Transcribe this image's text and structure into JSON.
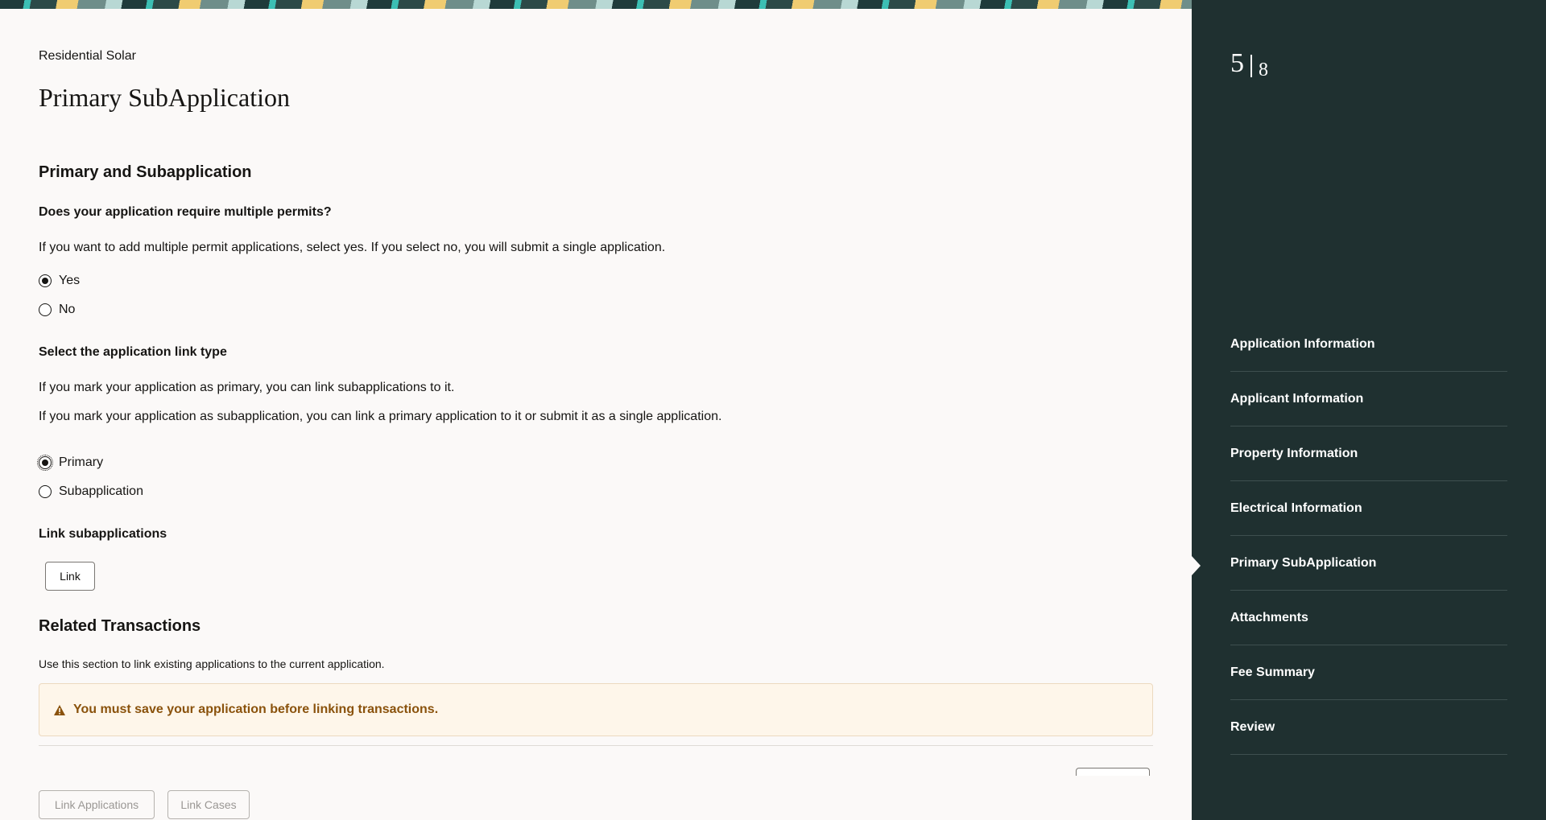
{
  "header": {
    "eyebrow": "Residential Solar",
    "title": "Primary SubApplication"
  },
  "section": {
    "title": "Primary and Subapplication",
    "multiple_permits": {
      "question": "Does your application require multiple permits?",
      "help": "If you want to add multiple permit applications, select yes. If you select no, you will submit a single application.",
      "options": [
        "Yes",
        "No"
      ],
      "selected": "Yes"
    },
    "link_type": {
      "question": "Select the application link type",
      "help1": "If you mark your application as primary, you can link subapplications to it.",
      "help2": "If you mark your application as subapplication, you can link a primary application to it or submit it as a single application.",
      "options": [
        "Primary",
        "Subapplication"
      ],
      "selected": "Primary"
    },
    "link_sub": {
      "title": "Link subapplications",
      "button": "Link"
    }
  },
  "related": {
    "title": "Related Transactions",
    "help": "Use this section to link existing applications to the current application.",
    "warning": "You must save your application before linking transactions.",
    "link_applications": "Link Applications",
    "link_cases": "Link Cases"
  },
  "sidebar": {
    "current_step": "5",
    "total_steps": "8",
    "items": [
      {
        "label": "Application Information"
      },
      {
        "label": "Applicant Information"
      },
      {
        "label": "Property Information"
      },
      {
        "label": "Electrical Information"
      },
      {
        "label": "Primary SubApplication"
      },
      {
        "label": "Attachments"
      },
      {
        "label": "Fee Summary"
      },
      {
        "label": "Review"
      }
    ],
    "active_index": 4
  },
  "colors": {
    "sidebar_bg": "#1f3030",
    "warning_text": "#8a520c",
    "warning_bg": "#fef6ea"
  }
}
